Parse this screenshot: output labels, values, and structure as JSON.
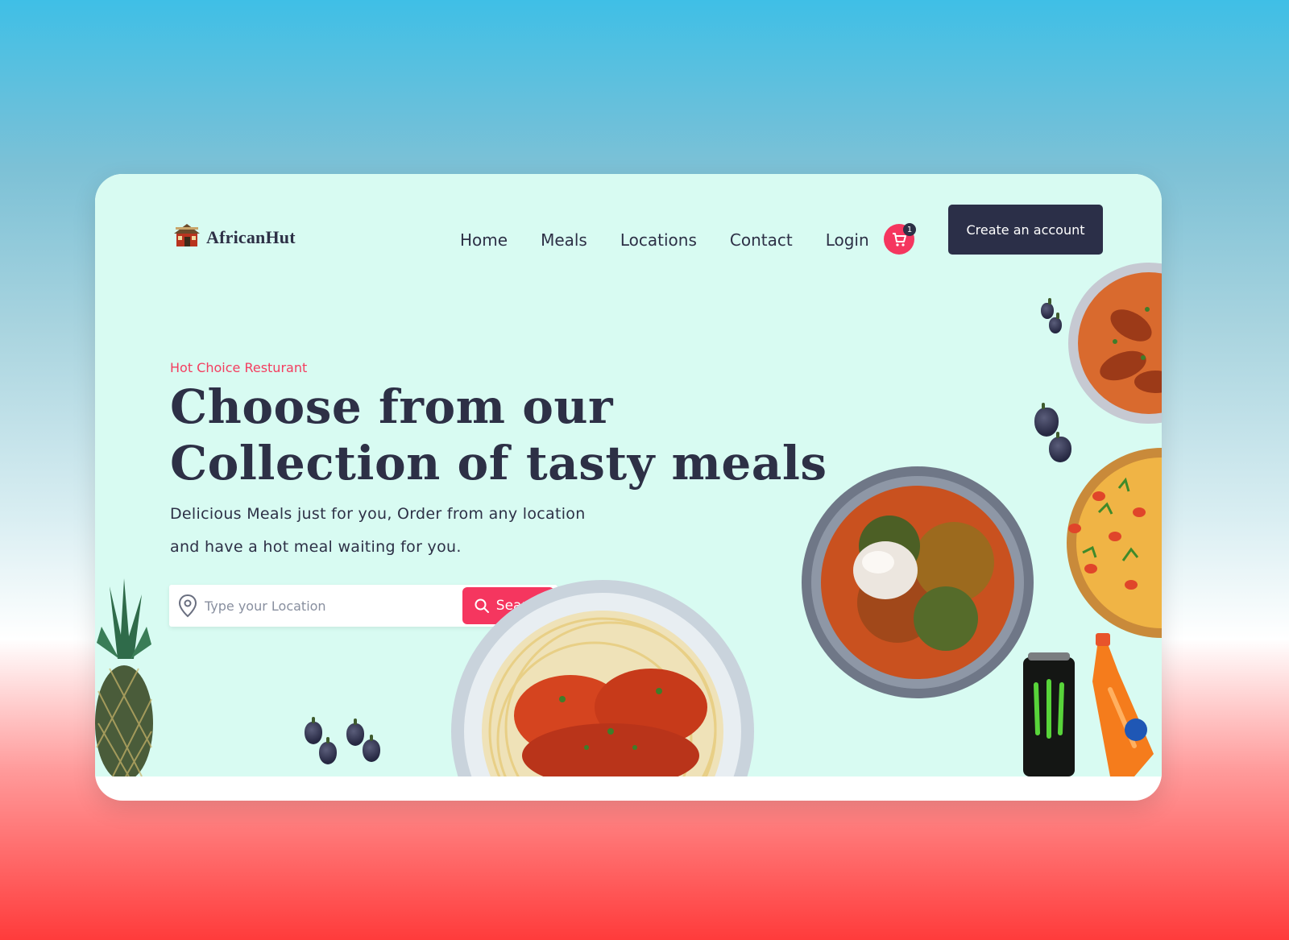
{
  "brand": {
    "name": "AfricanHut",
    "icon": "hut-icon"
  },
  "nav": {
    "items": [
      {
        "label": "Home"
      },
      {
        "label": "Meals"
      },
      {
        "label": "Locations"
      },
      {
        "label": "Contact"
      },
      {
        "label": "Login"
      }
    ]
  },
  "cart": {
    "icon": "cart-icon",
    "count": "1"
  },
  "cta": {
    "label": "Create an account"
  },
  "hero": {
    "kicker": "Hot Choice Resturant",
    "headline_line1": "Choose from our",
    "headline_line2": "Collection of tasty meals",
    "sub_line1": "Delicious Meals just for you, Order from any location",
    "sub_line2": "and have a hot meal waiting for you."
  },
  "search": {
    "placeholder": "Type your Location",
    "value": "",
    "button_label": "Search",
    "icon": "location-pin-icon",
    "button_icon": "search-icon"
  },
  "colors": {
    "accent": "#f5365f",
    "dark": "#2b2f48",
    "hero_bg": "#d8fbf2"
  }
}
